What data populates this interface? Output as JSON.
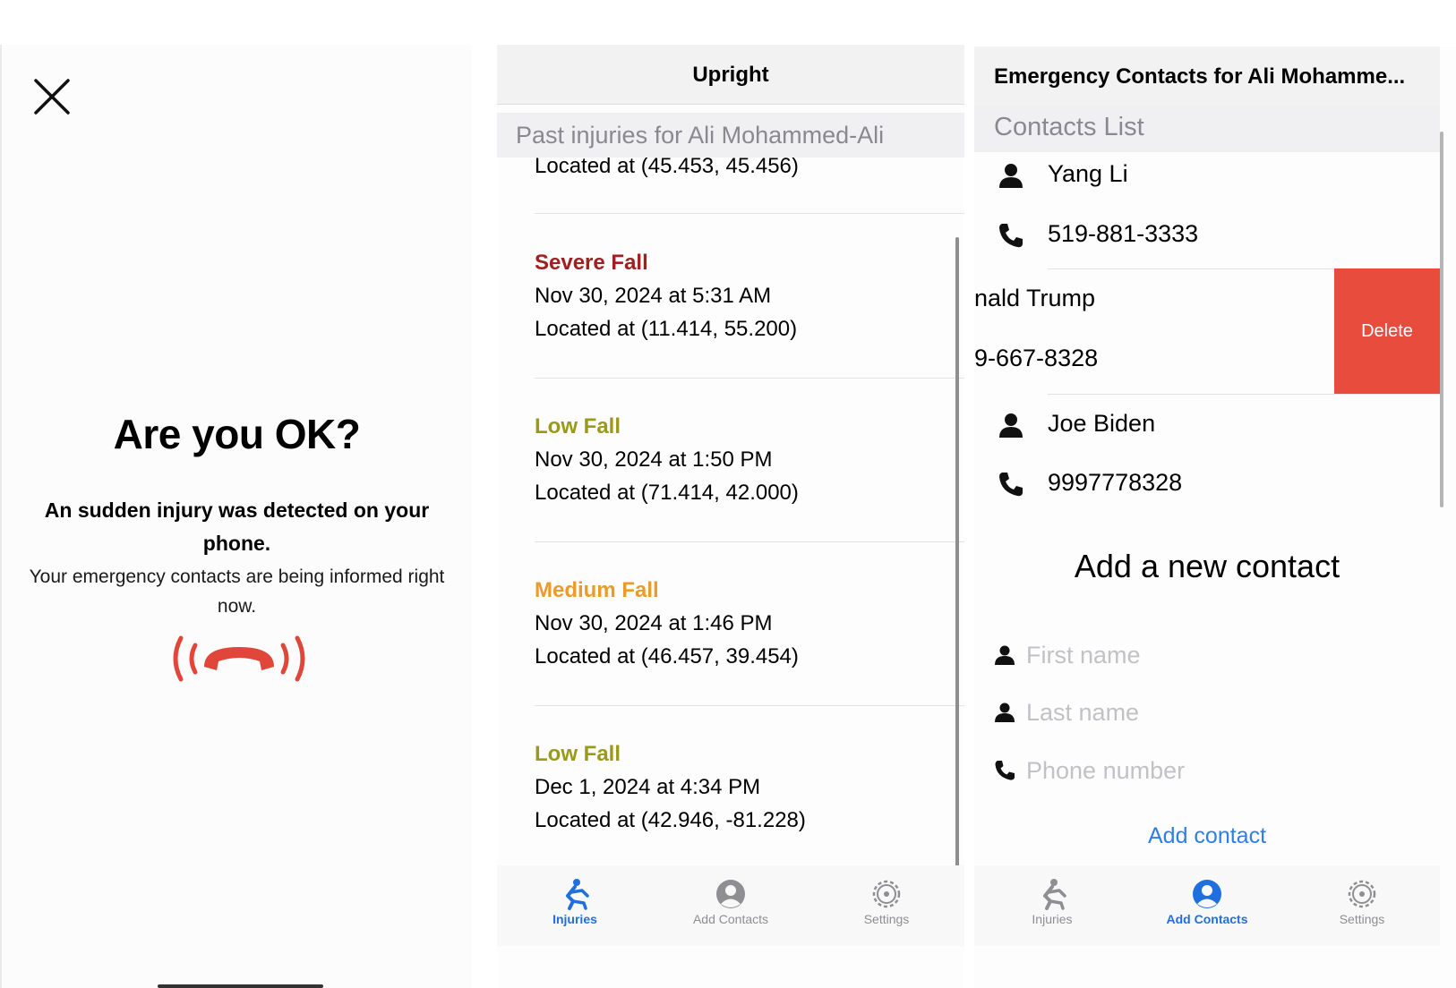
{
  "alert": {
    "title": "Are you OK?",
    "message": "An sudden injury was detected on your phone.",
    "subtitle": "Your emergency contacts are being informed right now."
  },
  "injuries_screen": {
    "nav_title": "Upright",
    "section_header": "Past injuries for Ali Mohammed-Ali",
    "cut_off_location": "Located at (45.453, 45.456)",
    "injuries": [
      {
        "severity": "Severe Fall",
        "datetime": "Nov 30, 2024 at 5:31 AM",
        "location": "Located at (11.414, 55.200)",
        "color": "#a01f1f"
      },
      {
        "severity": "Low Fall",
        "datetime": "Nov 30, 2024 at 1:50 PM",
        "location": "Located at (71.414, 42.000)",
        "color": "#9a9a1a"
      },
      {
        "severity": "Medium Fall",
        "datetime": "Nov 30, 2024 at 1:46 PM",
        "location": "Located at (46.457, 39.454)",
        "color": "#ec9a2a"
      },
      {
        "severity": "Low Fall",
        "datetime": "Dec 1, 2024 at 4:34 PM",
        "location": "Located at (42.946, -81.228)",
        "color": "#9a9a1a"
      }
    ]
  },
  "contacts_screen": {
    "nav_title": "Emergency Contacts for Ali Mohamme...",
    "section_header": "Contacts List",
    "contacts": [
      {
        "name": "Yang Li",
        "phone": "519-881-3333"
      },
      {
        "name": "nald Trump",
        "phone": "9-667-8328"
      },
      {
        "name": "Joe Biden",
        "phone": "9997778328"
      }
    ],
    "delete_label": "Delete",
    "add_title": "Add a new contact",
    "first_name_placeholder": "First name",
    "last_name_placeholder": "Last name",
    "phone_placeholder": "Phone number",
    "add_button_label": "Add contact"
  },
  "tabs": [
    {
      "label": "Injuries",
      "icon": "fall-icon"
    },
    {
      "label": "Add Contacts",
      "icon": "person-circle-icon"
    },
    {
      "label": "Settings",
      "icon": "gear-icon"
    }
  ],
  "colors": {
    "accent": "#1f6fde",
    "delete": "#e84c3d",
    "alert_icon": "#e0463a"
  }
}
